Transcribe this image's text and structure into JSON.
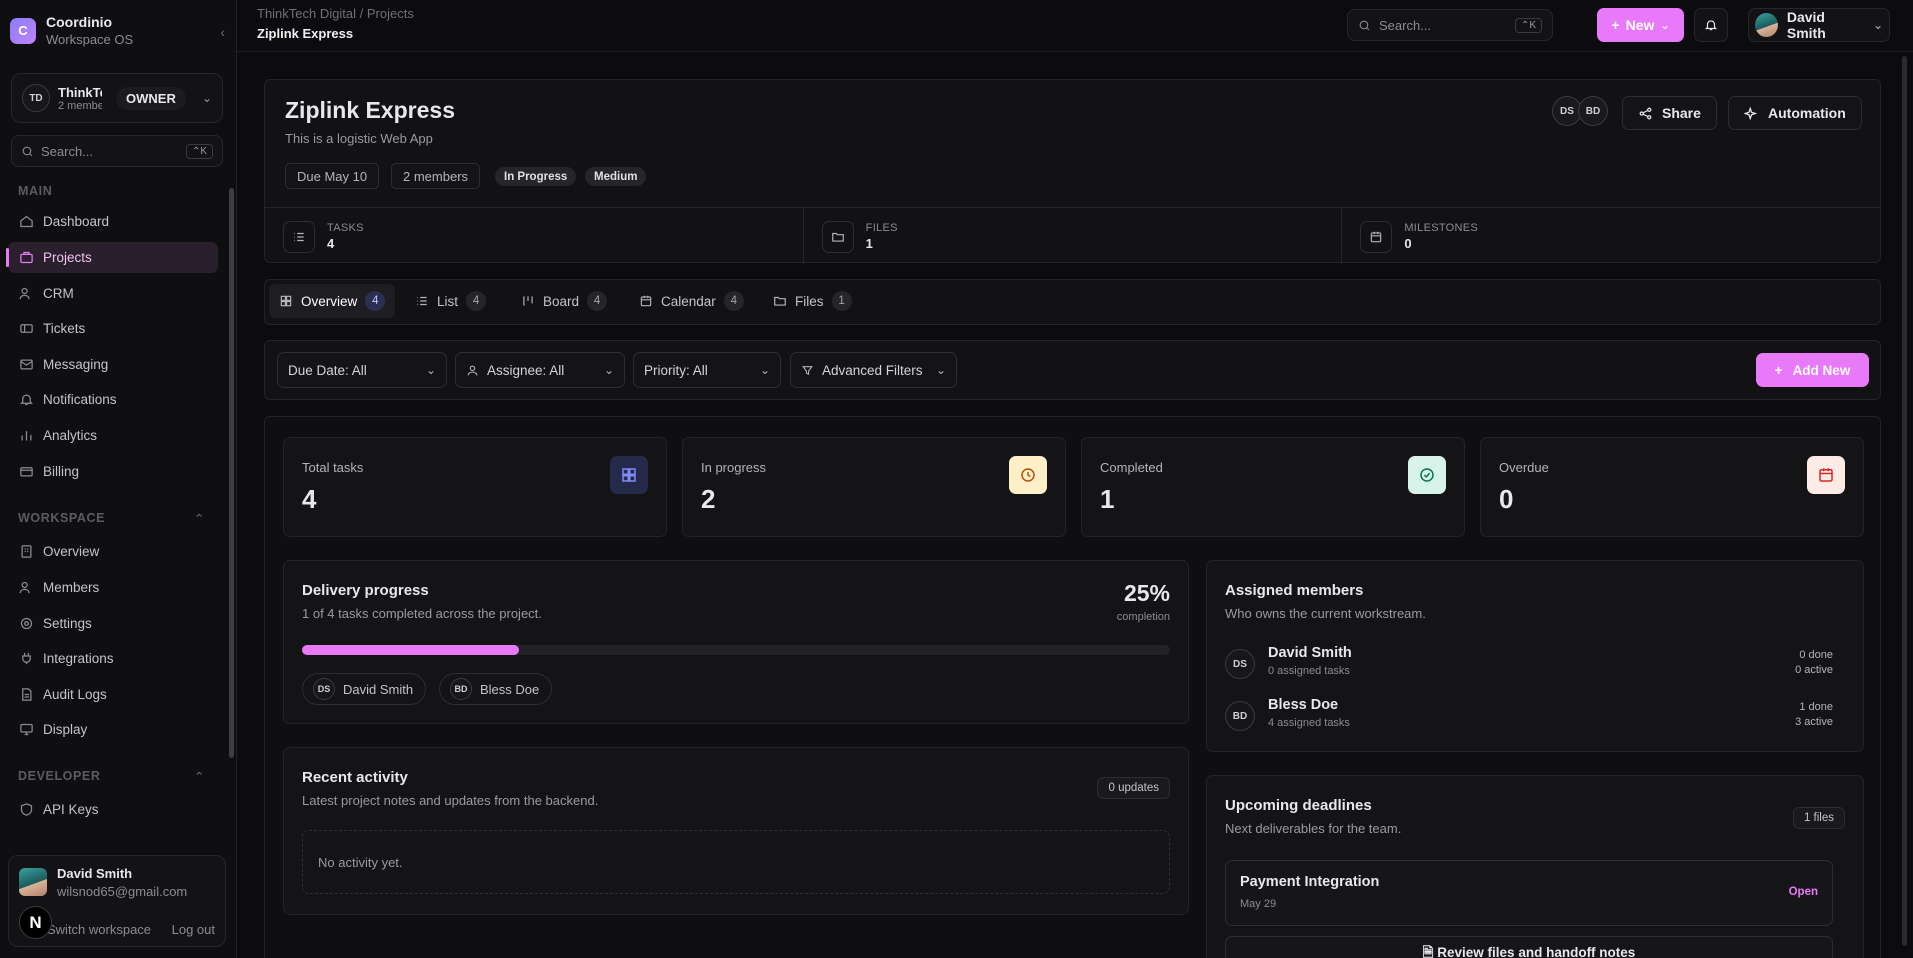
{
  "sidebar": {
    "brand": {
      "letter": "C",
      "title": "Coordinio",
      "subtitle": "Workspace OS"
    },
    "workspace": {
      "initials": "TD",
      "name": "ThinkTech Digital",
      "sub": "2 members",
      "role": "OWNER"
    },
    "search": {
      "placeholder": "Search...",
      "shortcut": "⌃K"
    },
    "sections": [
      {
        "title": "MAIN",
        "items": [
          {
            "label": "Dashboard",
            "icon": "home-icon"
          },
          {
            "label": "Projects",
            "icon": "briefcase-icon",
            "active": true
          },
          {
            "label": "CRM",
            "icon": "users-icon"
          },
          {
            "label": "Tickets",
            "icon": "ticket-icon"
          },
          {
            "label": "Messaging",
            "icon": "mail-icon"
          },
          {
            "label": "Notifications",
            "icon": "bell-icon"
          },
          {
            "label": "Analytics",
            "icon": "bar-chart-icon"
          },
          {
            "label": "Billing",
            "icon": "credit-card-icon"
          }
        ]
      },
      {
        "title": "WORKSPACE",
        "items": [
          {
            "label": "Overview",
            "icon": "building-icon"
          },
          {
            "label": "Members",
            "icon": "users-icon"
          },
          {
            "label": "Settings",
            "icon": "gear-icon"
          },
          {
            "label": "Integrations",
            "icon": "plug-icon"
          },
          {
            "label": "Audit Logs",
            "icon": "file-text-icon"
          },
          {
            "label": "Display",
            "icon": "monitor-icon"
          }
        ]
      },
      {
        "title": "DEVELOPER",
        "items": [
          {
            "label": "API Keys",
            "icon": "shield-icon"
          }
        ]
      }
    ],
    "user": {
      "name": "David Smith",
      "email": "wilsnod65@gmail.com",
      "switch": "Switch workspace",
      "logout": "Log out",
      "badge": "N"
    }
  },
  "topbar": {
    "breadcrumb": [
      "ThinkTech Digital",
      "Projects"
    ],
    "current": "Ziplink Express",
    "search": {
      "placeholder": "Search...",
      "shortcut": "⌃K"
    },
    "new_label": "New",
    "user_name": "David Smith"
  },
  "project": {
    "title": "Ziplink Express",
    "description": "This is a logistic Web App",
    "chips": {
      "due": "Due May 10",
      "members": "2 members"
    },
    "status": "In Progress",
    "priority": "Medium",
    "avatars": [
      "DS",
      "BD"
    ],
    "share_label": "Share",
    "automation_label": "Automation",
    "stats": [
      {
        "label": "TASKS",
        "value": "4"
      },
      {
        "label": "FILES",
        "value": "1"
      },
      {
        "label": "MILESTONES",
        "value": "0"
      }
    ]
  },
  "tabs": [
    {
      "label": "Overview",
      "count": "4",
      "active": true
    },
    {
      "label": "List",
      "count": "4"
    },
    {
      "label": "Board",
      "count": "4"
    },
    {
      "label": "Calendar",
      "count": "4"
    },
    {
      "label": "Files",
      "count": "1"
    }
  ],
  "filters": {
    "due": "Due Date: All",
    "assignee": "Assignee: All",
    "priority": "Priority: All",
    "advanced": "Advanced Filters",
    "add_new": "Add New"
  },
  "kpis": [
    {
      "label": "Total tasks",
      "value": "4",
      "color": "#818cf8",
      "bg": "#252a4a"
    },
    {
      "label": "In progress",
      "value": "2",
      "color": "#b45309",
      "bg": "#fdf0c8"
    },
    {
      "label": "Completed",
      "value": "1",
      "color": "#047857",
      "bg": "#d8f3ea"
    },
    {
      "label": "Overdue",
      "value": "0",
      "color": "#dc2626",
      "bg": "#fdece6"
    }
  ],
  "delivery": {
    "title": "Delivery progress",
    "subtitle": "1 of 4 tasks completed across the project.",
    "percent_label": "25%",
    "percent_value": 25,
    "percent_sub": "completion",
    "members": [
      {
        "initials": "DS",
        "name": "David Smith"
      },
      {
        "initials": "BD",
        "name": "Bless Doe"
      }
    ]
  },
  "activity": {
    "title": "Recent activity",
    "subtitle": "Latest project notes and updates from the backend.",
    "badge": "0 updates",
    "empty": "No activity yet."
  },
  "assigned": {
    "title": "Assigned members",
    "subtitle": "Who owns the current workstream.",
    "members": [
      {
        "initials": "DS",
        "name": "David Smith",
        "sub": "0 assigned tasks",
        "done": "0 done",
        "active": "0 active"
      },
      {
        "initials": "BD",
        "name": "Bless Doe",
        "sub": "4 assigned tasks",
        "done": "1 done",
        "active": "3 active"
      }
    ]
  },
  "deadlines": {
    "title": "Upcoming deadlines",
    "subtitle": "Next deliverables for the team.",
    "badge": "1 files",
    "items": [
      {
        "title": "Payment Integration",
        "date": "May 29",
        "action": "Open"
      },
      {
        "title": "Review files and handoff notes"
      }
    ]
  },
  "colors": {
    "accent": "#e879f9",
    "bg": "#0c0c0e"
  }
}
